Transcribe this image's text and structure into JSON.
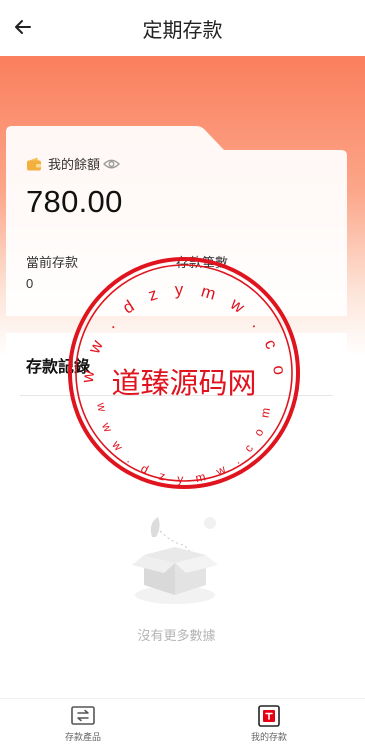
{
  "header": {
    "title": "定期存款"
  },
  "balance_card": {
    "label": "我的餘額",
    "amount": "780.00",
    "current_deposit": {
      "label": "當前存款",
      "value": "0"
    },
    "deposit_count": {
      "label": "存款筆數"
    }
  },
  "records": {
    "title": "存款記錄",
    "empty_text": "沒有更多數據"
  },
  "bottom_nav": {
    "items": [
      {
        "label": "存款產品",
        "icon": "deposit-products-icon"
      },
      {
        "label": "我的存款",
        "icon": "my-deposit-icon"
      }
    ]
  },
  "watermark": {
    "main_text": "道臻源码网",
    "ring_text": "w w w . d z y m w . c o m"
  },
  "colors": {
    "accent": "#fa7f5e",
    "stamp_red": "#e0141e",
    "nav_active": "#e60012"
  }
}
